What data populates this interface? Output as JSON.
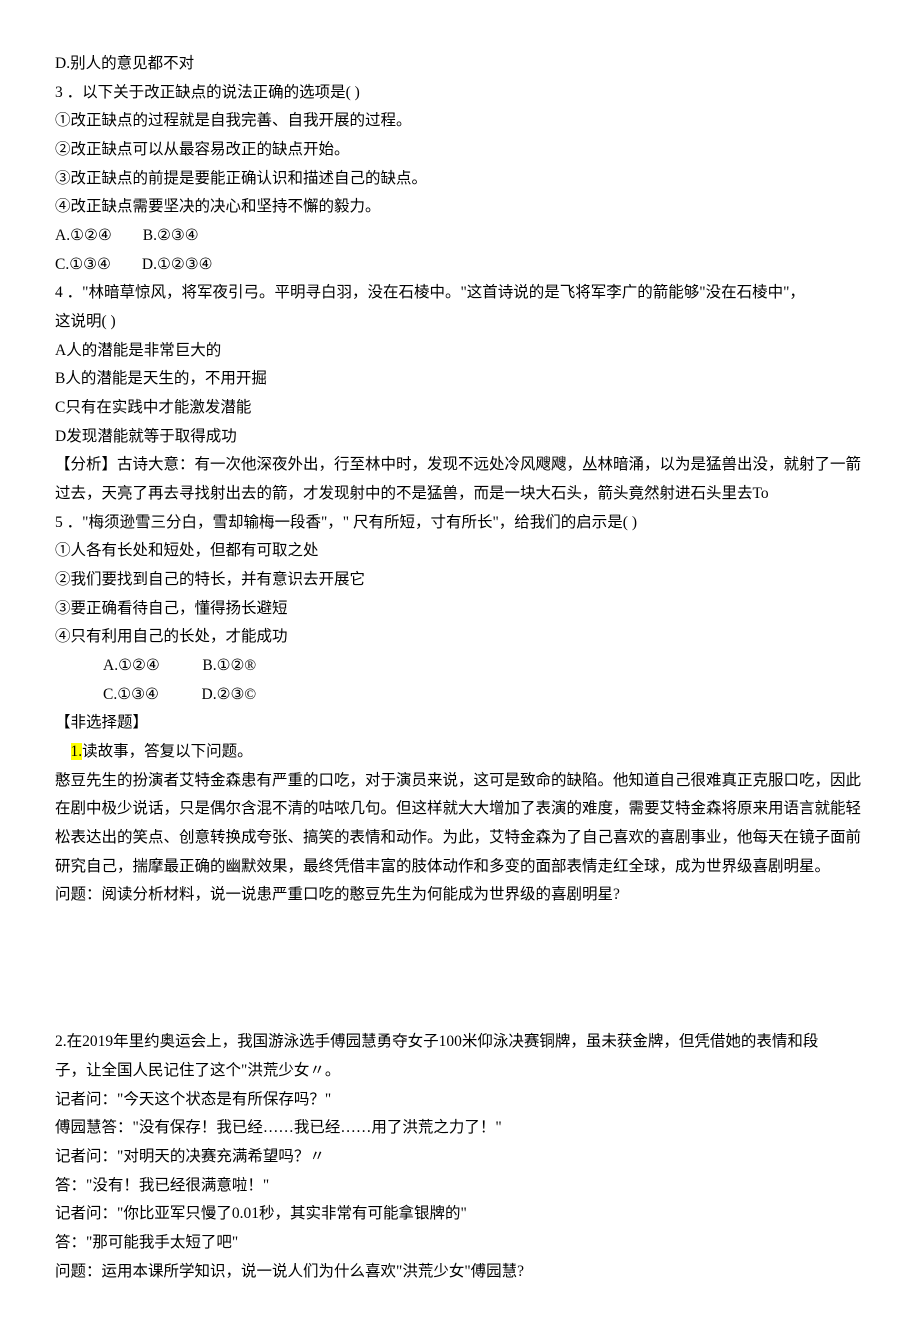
{
  "d_option": "D.别人的意见都不对",
  "q3": {
    "stem": "3 ．以下关于改正缺点的说法正确的选项是(            )",
    "s1": "①改正缺点的过程就是自我完善、自我开展的过程。",
    "s2": "②改正缺点可以从最容易改正的缺点开始。",
    "s3": "③改正缺点的前提是要能正确认识和描述自己的缺点。",
    "s4": "④改正缺点需要坚决的决心和坚持不懈的毅力。",
    "row1": "A.①②④        B.②③④",
    "row2": "C.①③④        D.①②③④"
  },
  "q4": {
    "stem1": "4 ．\"林暗草惊风，将军夜引弓。平明寻白羽，没在石棱中。\"这首诗说的是飞将军李广的箭能够\"没在石棱中\"，",
    "stem2": "这说明(                  )",
    "a": "A人的潜能是非常巨大的",
    "b": "B人的潜能是天生的，不用开掘",
    "c": "C只有在实践中才能激发潜能",
    "d": "D发现潜能就等于取得成功",
    "analysis": "【分析】古诗大意：有一次他深夜外出，行至林中时，发现不远处冷风飕飕，丛林暗涌，以为是猛兽出没，就射了一箭过去，天亮了再去寻找射出去的箭，才发现射中的不是猛兽，而是一块大石头，箭头竟然射进石头里去To"
  },
  "q5": {
    "stem": "5 ．\"梅须逊雪三分白，雪却输梅一段香\"，\" 尺有所短，寸有所长\"，给我们的启示是(            )",
    "s1": "①人各有长处和短处，但都有可取之处",
    "s2": "②我们要找到自己的特长，并有意识去开展它",
    "s3": "③要正确看待自己，懂得扬长避短",
    "s4": "④只有利用自己的长处，才能成功",
    "row1": "A.①②④           B.①②®",
    "row2": "C.①③④           D.②③©"
  },
  "non_choice_header": "【非选择题】",
  "essay1": {
    "prefix": "1.",
    "prompt": "读故事，答复以下问题。",
    "body": "憨豆先生的扮演者艾特金森患有严重的口吃，对于演员来说，这可是致命的缺陷。他知道自己很难真正克服口吃，因此在剧中极少说话，只是偶尔含混不清的咕哝几句。但这样就大大增加了表演的难度，需要艾特金森将原来用语言就能轻松表达出的笑点、创意转换成夸张、搞笑的表情和动作。为此，艾特金森为了自己喜欢的喜剧事业，他每天在镜子面前研究自己，揣摩最正确的幽默效果，最终凭借丰富的肢体动作和多变的面部表情走红全球，成为世界级喜剧明星。",
    "question": "问题：阅读分析材料，说一说患严重口吃的憨豆先生为何能成为世界级的喜剧明星?"
  },
  "essay2": {
    "l1": "2.在2019年里约奥运会上，我国游泳选手傅园慧勇夺女子100米仰泳决赛铜牌，虽未获金牌，但凭借她的表情和段",
    "l2": "子，让全国人民记住了这个\"洪荒少女〃。",
    "l3": "记者问：\"今天这个状态是有所保存吗？\"",
    "l4": "傅园慧答：\"没有保存！我已经……我已经……用了洪荒之力了！\"",
    "l5": "记者问：\"对明天的决赛充满希望吗？〃",
    "l6": "答：\"没有！我已经很满意啦！\"",
    "l7": "记者问：\"你比亚军只慢了0.01秒，其实非常有可能拿银牌的\"",
    "l8": "答：\"那可能我手太短了吧\"",
    "l9": "问题：运用本课所学知识，说一说人们为什么喜欢\"洪荒少女\"傅园慧?"
  }
}
